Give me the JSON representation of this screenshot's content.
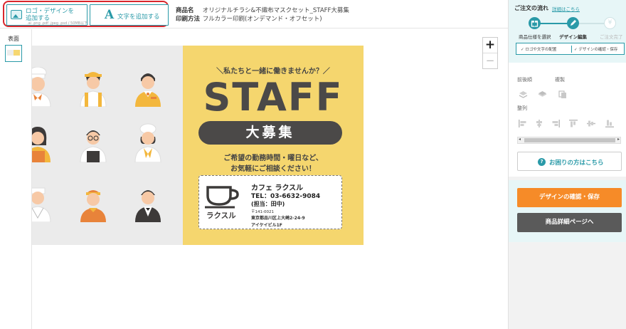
{
  "toolbar": {
    "add_logo_line1": "ロゴ・デザインを",
    "add_logo_line2": "追加する",
    "add_logo_hint": ".ai .png .pdf .jpeg .psd / 50MB以下",
    "add_text_icon": "A",
    "add_text_label": "文字を追加する"
  },
  "product": {
    "name_key": "商品名",
    "name_value": "オリジナルチラシ&不織布マスクセット_STAFF大募集",
    "print_key": "印刷方法",
    "print_value": "フルカラー印刷(オンデマンド・オフセット)"
  },
  "pages": {
    "label": "表面"
  },
  "zoom": {
    "in": "+",
    "out": "−"
  },
  "flyer": {
    "catch": "＼私たちと一緒に働きませんか？／",
    "staff": "STAFF",
    "pill": "大募集",
    "message_line1": "ご希望の勤務時間・曜日など、",
    "message_line2": "お気軽にご相談ください！",
    "brand": "ラクスル",
    "cafe_name": "カフェ ラクスル",
    "tel": "TEL：03-6632-9084",
    "contact": "(担当：田中)",
    "zip": "〒141-0021",
    "address_line1": "東京都品川区上大崎2-24-9",
    "address_line2": "アイケイビル1F"
  },
  "flow": {
    "title": "ご注文の流れ",
    "detail_link": "詳細はこちら",
    "steps": [
      {
        "label": "商品仕様を選択",
        "icon": "gift-icon"
      },
      {
        "label": "デザイン編集",
        "icon": "pencil-icon"
      },
      {
        "label": "ご注文完了",
        "icon": "yen-icon",
        "glyph": "¥"
      }
    ],
    "substeps": [
      "✓ ロゴや文字の配置",
      "✓ デザインの確認・保存"
    ]
  },
  "tools": {
    "order_label": "前後順",
    "copy_label": "複製",
    "align_label": "整列"
  },
  "help": {
    "label": "お困りの方はこちら",
    "glyph": "?"
  },
  "actions": {
    "confirm": "デザインの確認・保存",
    "detail": "商品詳細ページへ"
  },
  "colors": {
    "accent": "#2a9aa8",
    "highlight_border": "#d9262c",
    "flyer_yellow": "#f5d66e",
    "confirm_orange": "#f68b28",
    "dark_button": "#5a5a5a"
  }
}
